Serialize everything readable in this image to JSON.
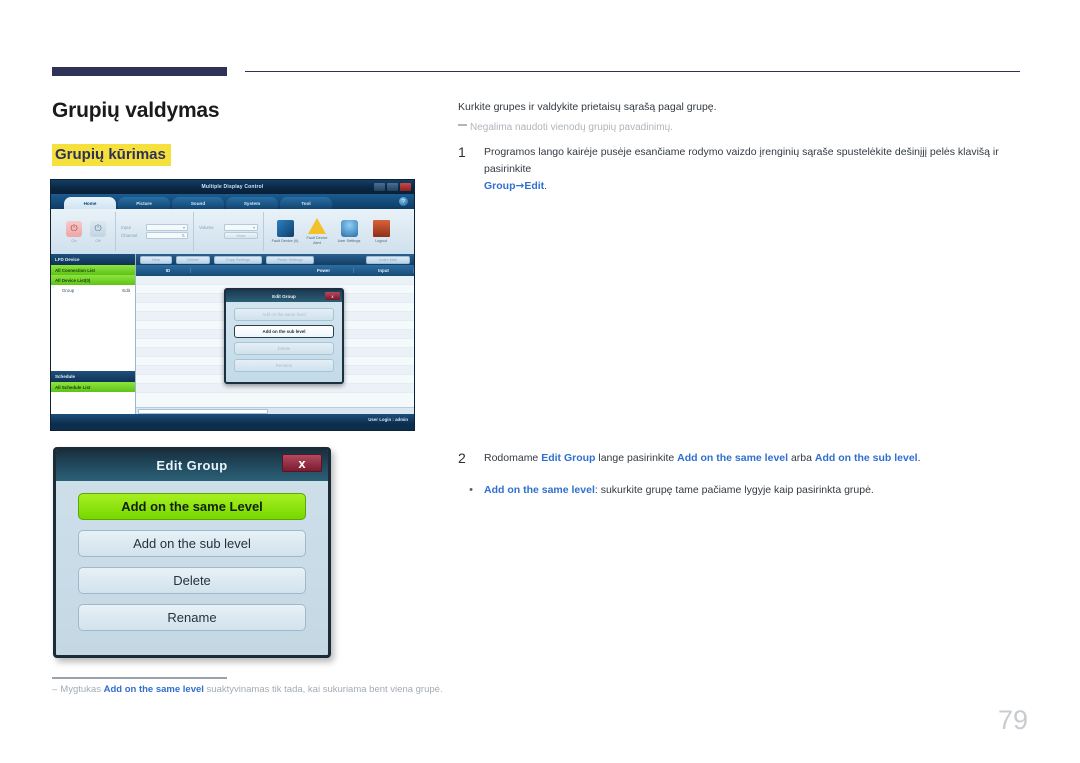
{
  "page": {
    "title": "Grupių valdymas",
    "section_title": "Grupių kūrimas",
    "number": "79"
  },
  "content": {
    "intro": "Kurkite grupes ir valdykite prietaisų sąrašą pagal grupę.",
    "note": "Negalima naudoti vienodų grupių pavadinimų.",
    "step1": {
      "num": "1",
      "text_before": "Programos lango kairėje pusėje esančiame rodymo vaizdo įrenginių sąraše spustelėkite dešinįjį pelės klavišą ir pasirinkite ",
      "link_group": "Group",
      "arrow": "→",
      "link_edit": "Edit",
      "period": "."
    },
    "step2": {
      "num": "2",
      "t1": "Rodomame ",
      "b1": "Edit Group",
      "t2": " lange pasirinkite ",
      "b2": "Add on the same level",
      "t3": " arba ",
      "b3": "Add on the sub level",
      "t4": "."
    },
    "bullet1": {
      "dot": "•",
      "b1": "Add on the same level",
      "t1": ": sukurkite grupę tame pačiame lygyje kaip pasirinkta grupė."
    },
    "footnote": {
      "dash": "–",
      "t1": "Mygtukas ",
      "b1": "Add on the same level",
      "t2": " suaktyvinamas tik tada, kai sukuriama bent viena grupė."
    }
  },
  "mdc_app": {
    "window_title": "Multiple Display Control",
    "window_controls": [
      "minimize",
      "maximize",
      "close"
    ],
    "help_icon": "?",
    "tabs": [
      {
        "label": "Home",
        "active": true
      },
      {
        "label": "Picture",
        "active": false
      },
      {
        "label": "Sound",
        "active": false
      },
      {
        "label": "System",
        "active": false
      },
      {
        "label": "Tool",
        "active": false
      }
    ],
    "ribbon": {
      "power_on": "On",
      "power_off": "Off",
      "input_label": "Input",
      "channel_label": "Channel",
      "volume_label": "Volume",
      "mute_label": "Mute",
      "icons": [
        {
          "label": "Fault Device (0)",
          "name": "fault-device-icon"
        },
        {
          "label": "Fault Device Alert",
          "name": "fault-device-alert-icon"
        },
        {
          "label": "User Settings",
          "name": "user-settings-icon"
        },
        {
          "label": "Logout",
          "name": "logout-icon"
        }
      ]
    },
    "sidebar": {
      "lfd_header": "LFD Device",
      "all_connection_list": "All Connection List",
      "all_device_list": "All Device List(0)",
      "group_row_label": "Group",
      "group_row_action": "Edit",
      "schedule_header": "Schedule",
      "all_schedule_list": "All Schedule List"
    },
    "toolbar_buttons": [
      "New",
      "Delete",
      "Copy Settings",
      "Paste Settings",
      "Index Mail"
    ],
    "grid_columns": [
      "",
      "ID",
      "",
      "Power",
      "Input"
    ],
    "status_bar": "User Login : admin",
    "inner_dialog": {
      "title": "Edit Group",
      "close": "x",
      "buttons": [
        {
          "label": "Add on the same level",
          "state": "disabled"
        },
        {
          "label": "Add on the sub level",
          "state": "highlighted"
        },
        {
          "label": "Delete",
          "state": "disabled"
        },
        {
          "label": "Rename",
          "state": "disabled"
        }
      ]
    }
  },
  "edit_group_dialog": {
    "title": "Edit Group",
    "close": "x",
    "buttons": [
      {
        "label": "Add on the same Level",
        "primary": true
      },
      {
        "label": "Add on the sub level",
        "primary": false
      },
      {
        "label": "Delete",
        "primary": false
      },
      {
        "label": "Rename",
        "primary": false
      }
    ]
  },
  "colors": {
    "navy": "#2e3257",
    "highlight_yellow": "#f5e03c",
    "link_blue": "#2f6fd0",
    "green_button": "#7fe000",
    "close_red": "#8c1f30"
  }
}
